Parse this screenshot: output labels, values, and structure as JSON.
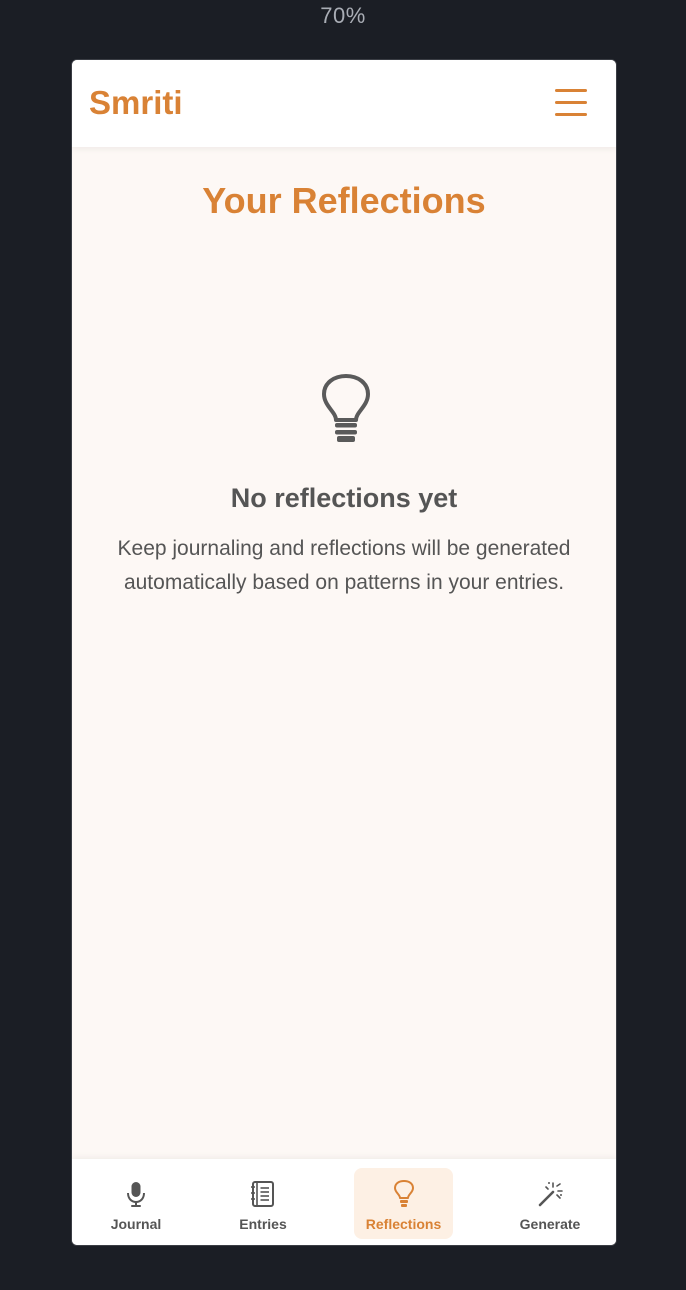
{
  "zoom_level": "70%",
  "header": {
    "brand": "Smriti",
    "menu_icon": "hamburger-menu-icon"
  },
  "main": {
    "title": "Your Reflections",
    "empty_state": {
      "icon": "lightbulb-icon",
      "title": "No reflections yet",
      "description": "Keep journaling and reflections will be generated automatically based on patterns in your entries."
    }
  },
  "bottom_nav": {
    "active": "Reflections",
    "items": [
      {
        "label": "Journal",
        "icon": "microphone-icon"
      },
      {
        "label": "Entries",
        "icon": "notebook-icon"
      },
      {
        "label": "Reflections",
        "icon": "lightbulb-icon"
      },
      {
        "label": "Generate",
        "icon": "magic-wand-icon"
      }
    ]
  },
  "colors": {
    "accent": "#d98235",
    "active_tab_background": "#fdf0e4",
    "page_background": "#fdf8f5",
    "text": "#555555",
    "outer_background": "#1b1e25"
  }
}
